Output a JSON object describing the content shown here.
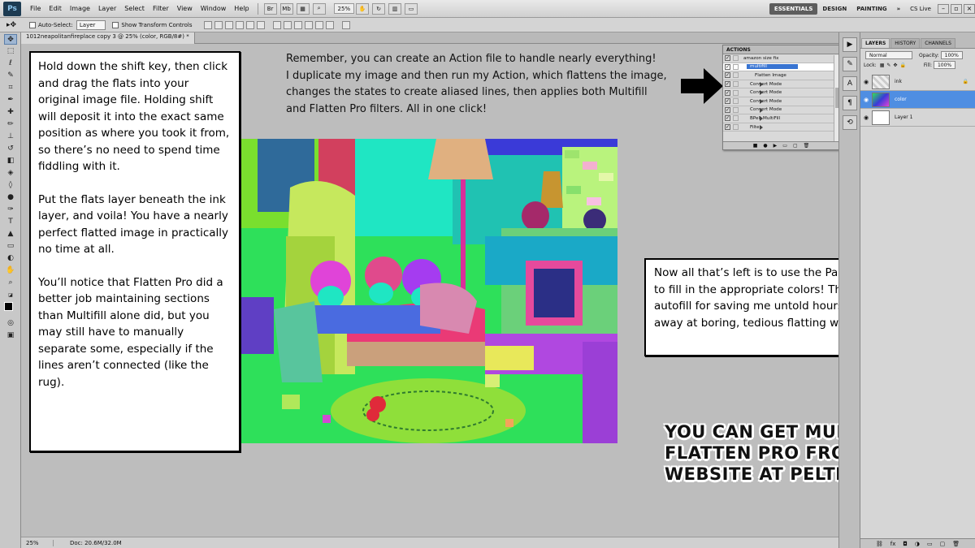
{
  "app": {
    "logo": "Ps",
    "menu": [
      "File",
      "Edit",
      "Image",
      "Layer",
      "Select",
      "Filter",
      "View",
      "Window",
      "Help"
    ],
    "zoom": "25%",
    "workspaces": [
      "ESSENTIALS",
      "DESIGN",
      "PAINTING"
    ],
    "cslive": "CS Live"
  },
  "options_bar": {
    "auto_select_label": "Auto-Select:",
    "auto_select_value": "Layer",
    "transform_label": "Show Transform Controls"
  },
  "document": {
    "tab_title": "1012neapolitanfireplace copy 3 @ 25% (color, RGB/8#) *",
    "status_zoom": "25%",
    "status_doc": "Doc: 20.6M/32.0M"
  },
  "left_box": {
    "paragraphs": [
      "Hold down the shift key, then click and drag the flats into your original image file. Holding shift will deposit it into the exact same position as where you took it from, so there’s no need to spend time fiddling with it.",
      "Put the flats layer beneath the ink layer, and voila! You have a nearly perfect flatted image in practically no time at all.",
      "You’ll notice that Flatten Pro did a better job maintaining sections than Multifill alone did, but you may still have to manually separate some, especially if the lines aren’t connected (like the rug)."
    ]
  },
  "top_note": {
    "lines": [
      "Remember, you can create an Action file to handle nearly everything!",
      "I duplicate my image and then run my Action, which flattens the image,",
      "changes the states to create aliased lines, then applies both Multifill",
      "and Flatten Pro filters. All in one click!"
    ]
  },
  "right_box": {
    "text": "Now all that’s left is to use the Paint Bucket tool to fill in the appropriate colors! Thank you autofill for saving me untold hours spent slaving away at boring, tedious flatting work!"
  },
  "promo": {
    "lines": [
      "YOU CAN GET MULTIFILL AND",
      "FLATTEN PRO FROM BPELT’S",
      "WEBSITE AT PELTMADE.COM!"
    ]
  },
  "actions_panel": {
    "title": "ACTIONS",
    "rows": [
      {
        "label": "amazon size fix",
        "kind": "top"
      },
      {
        "label": "multifill",
        "kind": "hi"
      },
      {
        "label": "Flatten Image",
        "kind": "sub2"
      },
      {
        "label": "Convert Mode",
        "kind": "sub"
      },
      {
        "label": "Convert Mode",
        "kind": "sub"
      },
      {
        "label": "Convert Mode",
        "kind": "sub"
      },
      {
        "label": "Convert Mode",
        "kind": "sub"
      },
      {
        "label": "BPelt MultiFill",
        "kind": "sub"
      },
      {
        "label": "Filter",
        "kind": "sub"
      }
    ]
  },
  "layers_panel": {
    "tabs": [
      "LAYERS",
      "HISTORY",
      "CHANNELS"
    ],
    "blend_mode": "Normal",
    "opacity_label": "Opacity:",
    "opacity": "100%",
    "lock_label": "Lock:",
    "fill_label": "Fill:",
    "fill": "100%",
    "layers": [
      {
        "name": "ink",
        "selected": false
      },
      {
        "name": "color",
        "selected": true
      },
      {
        "name": "Layer 1",
        "selected": false
      }
    ]
  },
  "colors": {
    "selected_layer": "#4f8ee2",
    "canvas_bg": "#bdbdbd"
  }
}
